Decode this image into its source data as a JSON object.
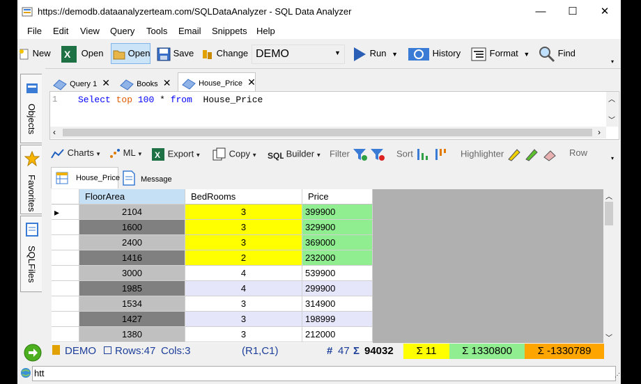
{
  "window": {
    "title": "https://demodb.dataanalyzerteam.com/SQLDataAnalyzer - SQL Data Analyzer",
    "minimize": "—",
    "maximize": "☐",
    "close": "✕"
  },
  "menu": [
    "File",
    "Edit",
    "View",
    "Query",
    "Tools",
    "Email",
    "Snippets",
    "Help"
  ],
  "toolbar": {
    "new": "New",
    "open_excel": "Open",
    "open": "Open",
    "save": "Save",
    "change": "Change",
    "database": "DEMO",
    "run": "Run",
    "history": "History",
    "format": "Format",
    "find": "Find"
  },
  "left_dock": [
    "Objects",
    "Favorites",
    "SQLFiles"
  ],
  "query_tabs": [
    {
      "label": "Query 1",
      "active": false
    },
    {
      "label": "Books",
      "active": false
    },
    {
      "label": "House_Price",
      "active": true
    }
  ],
  "editor": {
    "line_number": "1",
    "kw_select": "Select",
    "kw_top": "top",
    "num": "100",
    "star": "*",
    "kw_from": "from",
    "table": "House_Price"
  },
  "result_toolbar": {
    "charts": "Charts",
    "ml": "ML",
    "export": "Export",
    "copy": "Copy",
    "builder": "Builder",
    "filter": "Filter",
    "sort": "Sort",
    "highlighter": "Highlighter",
    "row": "Row"
  },
  "result_tabs": [
    "House_Price",
    "Message"
  ],
  "grid": {
    "columns": [
      "FloorArea",
      "BedRooms",
      "Price"
    ],
    "rows": [
      [
        "2104",
        "3",
        "399900"
      ],
      [
        "1600",
        "3",
        "329900"
      ],
      [
        "2400",
        "3",
        "369000"
      ],
      [
        "1416",
        "2",
        "232000"
      ],
      [
        "3000",
        "4",
        "539900"
      ],
      [
        "1985",
        "4",
        "299900"
      ],
      [
        "1534",
        "3",
        "314900"
      ],
      [
        "1427",
        "3",
        "198999"
      ],
      [
        "1380",
        "3",
        "212000"
      ]
    ],
    "colors": {
      "yellow": "#ffff00",
      "green": "#90ee90",
      "dark": "#808080",
      "light": "#c0c0c0",
      "lavender": "#e6e6fa",
      "header_sel": "#c5dff5"
    }
  },
  "status": {
    "db": "DEMO",
    "rows": "Rows:47",
    "cols": "Cols:3",
    "pos": "(R1,C1)",
    "count": "47",
    "sum_sel": "94032",
    "yellow_sum": "Σ 11",
    "green_sum": "Σ 1330800",
    "orange_sum": "Σ -1330789"
  },
  "address": "htt"
}
